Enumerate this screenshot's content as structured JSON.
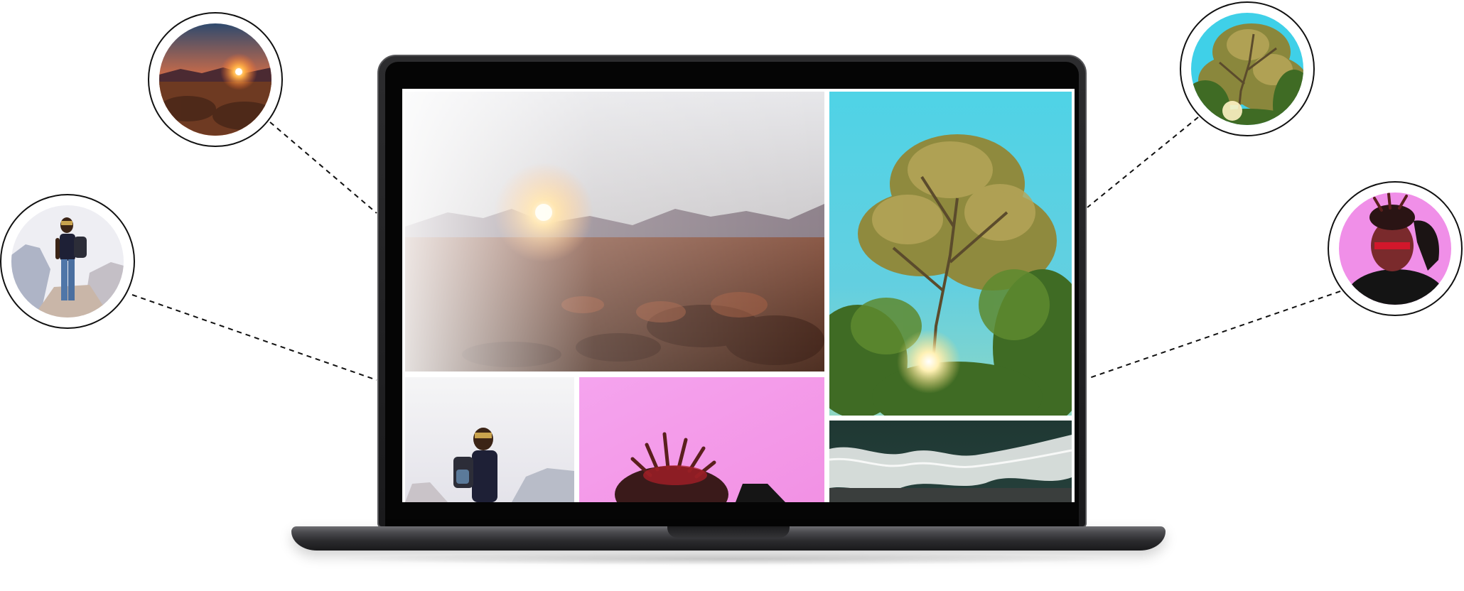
{
  "scene": {
    "background_color": "#ffffff",
    "device": "laptop",
    "connector_style": "dashed"
  },
  "gallery": {
    "tiles": [
      {
        "subject": "sunset-over-mountains"
      },
      {
        "subject": "tree-canopy-blue-sky"
      },
      {
        "subject": "hiker-with-backpack"
      },
      {
        "subject": "portrait-pink-backdrop"
      },
      {
        "subject": "ocean-waves-aerial"
      }
    ]
  },
  "avatars": [
    {
      "subject": "sunset-over-mountains",
      "side": "left"
    },
    {
      "subject": "hiker-with-backpack",
      "side": "left"
    },
    {
      "subject": "tree-canopy-blue-sky",
      "side": "right"
    },
    {
      "subject": "portrait-pink-backdrop",
      "side": "right"
    }
  ]
}
